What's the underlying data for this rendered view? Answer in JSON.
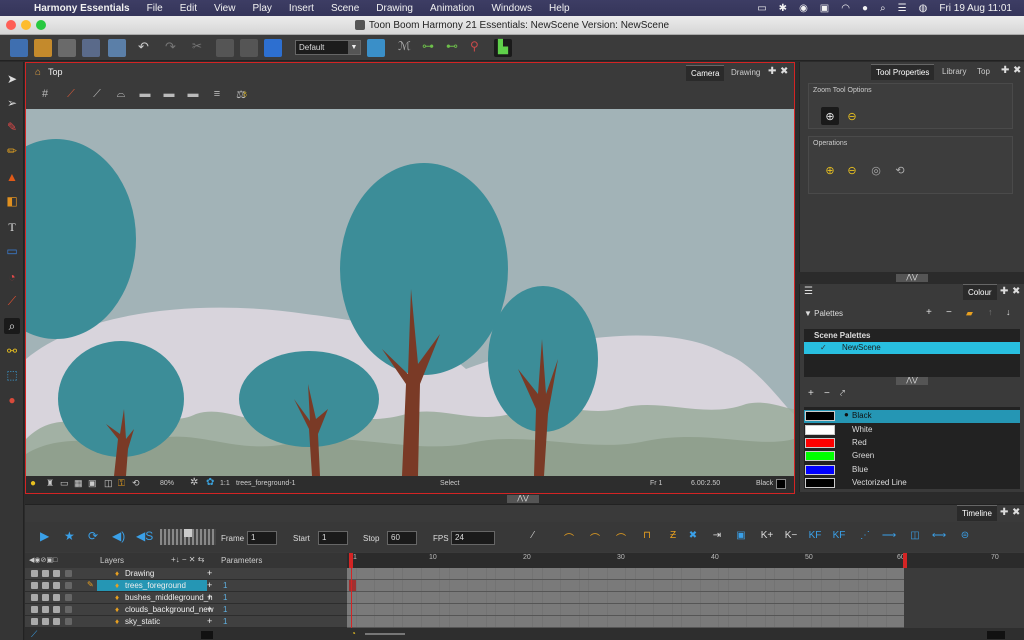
{
  "menubar": {
    "app_name": "Harmony Essentials",
    "items": [
      "File",
      "Edit",
      "View",
      "Play",
      "Insert",
      "Scene",
      "Drawing",
      "Animation",
      "Windows",
      "Help"
    ],
    "datetime": "Fri 19 Aug  11:01"
  },
  "window": {
    "title": "Toon Boom Harmony 21 Essentials: NewScene Version: NewScene"
  },
  "toolbar": {
    "view_select": "Default"
  },
  "camera_view": {
    "title": "Top",
    "tabs": [
      "Camera",
      "Drawing"
    ],
    "status": {
      "zoom": "80%",
      "ratio": "1:1",
      "layer": "trees_foreground-1",
      "tool": "Select",
      "frame": "Fr 1",
      "coords": "6.00:2.50",
      "colour": "Black"
    }
  },
  "tool_properties": {
    "tabs": [
      "Tool Properties",
      "Library",
      "Top"
    ],
    "zoom_group_label": "Zoom Tool Options",
    "operations_label": "Operations"
  },
  "colour_panel": {
    "tab": "Colour",
    "palettes_label": "Palettes",
    "scene_palettes_label": "Scene Palettes",
    "palette_item": "NewScene",
    "swatches": [
      {
        "name": "Black",
        "color": "#000000",
        "selected": true
      },
      {
        "name": "White",
        "color": "#ffffff",
        "selected": false
      },
      {
        "name": "Red",
        "color": "#ff0000",
        "selected": false
      },
      {
        "name": "Green",
        "color": "#00ff00",
        "selected": false
      },
      {
        "name": "Blue",
        "color": "#0000ff",
        "selected": false
      },
      {
        "name": "Vectorized Line",
        "color": "#000000",
        "selected": false
      }
    ]
  },
  "timeline": {
    "tab": "Timeline",
    "frame_label": "Frame",
    "frame_value": "1",
    "start_label": "Start",
    "start_value": "1",
    "stop_label": "Stop",
    "stop_value": "60",
    "fps_label": "FPS",
    "fps_value": "24",
    "layers_label": "Layers",
    "parameters_label": "Parameters",
    "ruler_ticks": [
      "1",
      "10",
      "20",
      "30",
      "40",
      "50",
      "60",
      "70"
    ],
    "layers": [
      {
        "name": "Drawing",
        "param": ""
      },
      {
        "name": "trees_foreground",
        "param": "1",
        "selected": true
      },
      {
        "name": "bushes_middleground_n",
        "param": "1"
      },
      {
        "name": "clouds_background_new",
        "param": "1"
      },
      {
        "name": "sky_static",
        "param": "1"
      }
    ]
  },
  "colors": {
    "accent": "#2596b4",
    "camera_border": "#d42424",
    "stage_bg": "#a2b3b7",
    "tree_teal": "#3c8d98",
    "trunk": "#7a3a26"
  }
}
